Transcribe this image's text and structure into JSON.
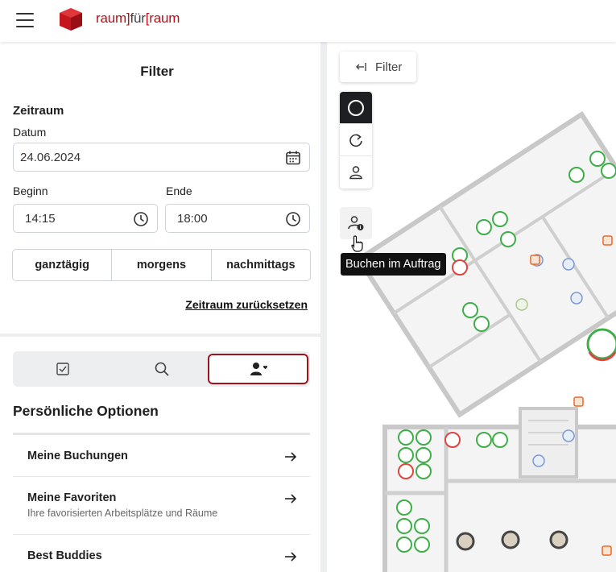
{
  "header": {
    "logo_left": "raum]",
    "logo_mid": "für",
    "logo_right": "[raum"
  },
  "filter": {
    "title": "Filter",
    "zeitraum_heading": "Zeitraum",
    "datum_label": "Datum",
    "datum_value": "24.06.2024",
    "beginn_label": "Beginn",
    "beginn_value": "14:15",
    "ende_label": "Ende",
    "ende_value": "18:00",
    "presets": [
      "ganztägig",
      "morgens",
      "nachmittags"
    ],
    "reset_label": "Zeitraum zurücksetzen"
  },
  "tabs": {
    "items": [
      "checkbox-icon",
      "search-icon",
      "person-heart-icon"
    ],
    "active_index": 2
  },
  "personal": {
    "title": "Persönliche Optionen",
    "items": [
      {
        "title": "Meine Buchungen",
        "subtitle": ""
      },
      {
        "title": "Meine Favoriten",
        "subtitle": "Ihre favorisierten Arbeitsplätze und Räume"
      },
      {
        "title": "Best Buddies",
        "subtitle": ""
      }
    ]
  },
  "map": {
    "filter_button": "Filter",
    "tooltip": "Buchen im Auftrag"
  },
  "colors": {
    "brand_red": "#b5121b",
    "active_tab_border": "#a2121b",
    "free_green": "#3fae49",
    "busy_red": "#e0443e"
  }
}
